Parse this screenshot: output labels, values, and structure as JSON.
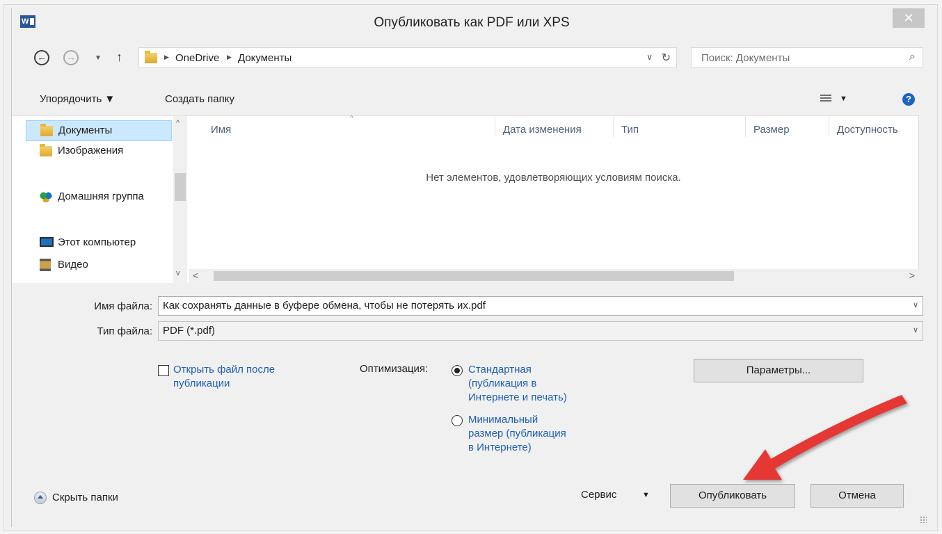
{
  "window": {
    "title": "Опубликовать как PDF или XPS",
    "close_glyph": "✕",
    "app_icon_text": "W"
  },
  "nav": {
    "back_glyph": "←",
    "forward_glyph": "→",
    "recent_glyph": "▼",
    "up_glyph": "↑"
  },
  "address": {
    "crumbs": [
      "OneDrive",
      "Документы"
    ],
    "sep_glyph": "▶",
    "dropdown_glyph": "∨",
    "refresh_glyph": "↻"
  },
  "search": {
    "placeholder": "Поиск: Документы",
    "icon_glyph": "⌕"
  },
  "toolbar": {
    "organize_label": "Упорядочить ▼",
    "new_folder_label": "Создать папку",
    "view_dd_glyph": "▼",
    "help_glyph": "?"
  },
  "sidebar": {
    "items": [
      {
        "label": "Документы",
        "icon": "folder-icon",
        "selected": true
      },
      {
        "label": "Изображения",
        "icon": "folder-icon"
      },
      {
        "label": "Домашняя группа",
        "icon": "homegroup-icon"
      },
      {
        "label": "Этот компьютер",
        "icon": "computer-icon"
      },
      {
        "label": "Видео",
        "icon": "video-icon"
      }
    ],
    "scroll_up_glyph": "^",
    "scroll_down_glyph": "v"
  },
  "file_list": {
    "columns": [
      "Имя",
      "Дата изменения",
      "Тип",
      "Размер",
      "Доступность"
    ],
    "sort_glyph": "^",
    "empty_message": "Нет элементов, удовлетворяющих условиям поиска.",
    "scroll_left_glyph": "<",
    "scroll_right_glyph": ">"
  },
  "form": {
    "filename_label": "Имя файла:",
    "filename_value": "Как сохранять данные в буфере обмена, чтобы не потерять их.pdf",
    "filetype_label": "Тип файла:",
    "filetype_value": "PDF (*.pdf)",
    "dd_glyph": "∨"
  },
  "options": {
    "open_after_label_1": "Открыть файл после",
    "open_after_label_2": "публикации",
    "open_after_checked": false,
    "optimize_label": "Оптимизация:",
    "standard_lines": [
      "Стандартная",
      "(публикация в",
      "Интернете и печать)"
    ],
    "minimal_lines": [
      "Минимальный",
      "размер (публикация",
      "в Интернете)"
    ],
    "selected": "standard",
    "params_button": "Параметры..."
  },
  "footer": {
    "hide_folders_label": "Скрыть папки",
    "service_label": "Сервис",
    "service_dd_glyph": "▼",
    "publish_button": "Опубликовать",
    "cancel_button": "Отмена"
  },
  "colors": {
    "arrow": "#e53935",
    "link": "#1c5fb8",
    "selection": "#cce8ff"
  }
}
